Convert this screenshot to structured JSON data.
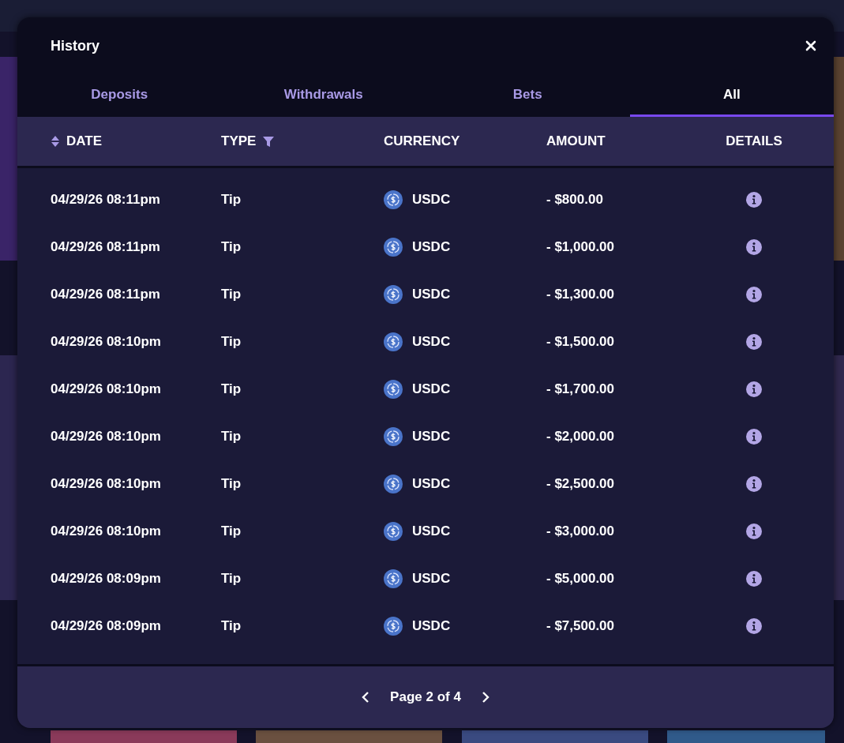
{
  "modal": {
    "title": "History"
  },
  "tabs": [
    {
      "label": "Deposits",
      "selected": false
    },
    {
      "label": "Withdrawals",
      "selected": false
    },
    {
      "label": "Bets",
      "selected": false
    },
    {
      "label": "All",
      "selected": true
    }
  ],
  "table": {
    "columns": [
      {
        "label": "DATE",
        "kind": "sort"
      },
      {
        "label": "TYPE",
        "kind": "filter"
      },
      {
        "label": "CURRENCY",
        "kind": "plain"
      },
      {
        "label": "AMOUNT",
        "kind": "plain"
      },
      {
        "label": "DETAILS",
        "kind": "center"
      }
    ],
    "rows": [
      {
        "date": "04/29/26 08:11pm",
        "type": "Tip",
        "currency": "USDC",
        "amount": "- $800.00"
      },
      {
        "date": "04/29/26 08:11pm",
        "type": "Tip",
        "currency": "USDC",
        "amount": "- $1,000.00"
      },
      {
        "date": "04/29/26 08:11pm",
        "type": "Tip",
        "currency": "USDC",
        "amount": "- $1,300.00"
      },
      {
        "date": "04/29/26 08:10pm",
        "type": "Tip",
        "currency": "USDC",
        "amount": "- $1,500.00"
      },
      {
        "date": "04/29/26 08:10pm",
        "type": "Tip",
        "currency": "USDC",
        "amount": "- $1,700.00"
      },
      {
        "date": "04/29/26 08:10pm",
        "type": "Tip",
        "currency": "USDC",
        "amount": "- $2,000.00"
      },
      {
        "date": "04/29/26 08:10pm",
        "type": "Tip",
        "currency": "USDC",
        "amount": "- $2,500.00"
      },
      {
        "date": "04/29/26 08:10pm",
        "type": "Tip",
        "currency": "USDC",
        "amount": "- $3,000.00"
      },
      {
        "date": "04/29/26 08:09pm",
        "type": "Tip",
        "currency": "USDC",
        "amount": "- $5,000.00"
      },
      {
        "date": "04/29/26 08:09pm",
        "type": "Tip",
        "currency": "USDC",
        "amount": "- $7,500.00"
      }
    ]
  },
  "pagination": {
    "label": "Page 2 of 4"
  }
}
